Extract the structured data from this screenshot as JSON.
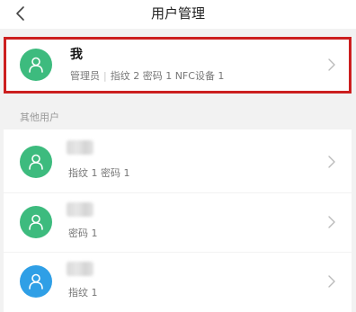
{
  "header": {
    "title": "用户管理"
  },
  "me": {
    "name": "我",
    "role": "管理员",
    "detail": "指纹 2  密码 1  NFC设备 1",
    "avatar_color": "#3dbb7e"
  },
  "others_label": "其他用户",
  "users": [
    {
      "detail": "指纹 1  密码 1",
      "avatar_color": "#3dbb7e"
    },
    {
      "detail": "密码 1",
      "avatar_color": "#3dbb7e"
    },
    {
      "detail": "指纹 1",
      "avatar_color": "#2f9fe6"
    }
  ]
}
